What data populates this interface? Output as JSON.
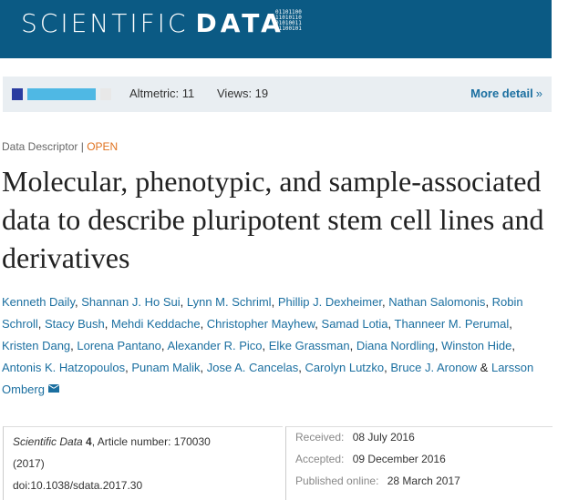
{
  "masthead": {
    "logo_text": "SCIENTIFIC",
    "logo_data": "DATA",
    "logo_binary": "01101100\n11010110\n01010011\n01100101"
  },
  "metrics": {
    "altmetric_label": "Altmetric: 11",
    "views_label": "Views: 19",
    "more_detail": "More detail",
    "more_detail_icon": "double-chevron-right",
    "altmetric_colors": [
      "#2a3ca0",
      "#4fb8e4",
      "#4fb8e4",
      "#4fb8e4",
      "#e8e8e8"
    ]
  },
  "article": {
    "type": "Data Descriptor",
    "separator": "|",
    "access": "OPEN",
    "title": "Molecular, phenotypic, and sample-associated data to describe pluripotent stem cell lines and derivatives"
  },
  "authors": [
    "Kenneth Daily",
    "Shannan J. Ho Sui",
    "Lynn M. Schriml",
    "Phillip J. Dexheimer",
    "Nathan Salomonis",
    "Robin Schroll",
    "Stacy Bush",
    "Mehdi Keddache",
    "Christopher Mayhew",
    "Samad Lotia",
    "Thanneer M. Perumal",
    "Kristen Dang",
    "Lorena Pantano",
    "Alexander R. Pico",
    "Elke Grassman",
    "Diana Nordling",
    "Winston Hide",
    "Antonis K. Hatzopoulos",
    "Punam Malik",
    "Jose A. Cancelas",
    "Carolyn Lutzko",
    "Bruce J. Aronow",
    "Larsson Omberg"
  ],
  "authors_last_sep": "&",
  "citation": {
    "journal": "Scientific Data",
    "volume": "4",
    "article_number": ", Article number: 170030",
    "year": "(2017)",
    "doi": "doi:10.1038/sdata.2017.30"
  },
  "dates": {
    "received_label": "Received:",
    "received": "08 July 2016",
    "accepted_label": "Accepted:",
    "accepted": "09 December 2016",
    "published_label": "Published online:",
    "published": "28 March 2017"
  }
}
